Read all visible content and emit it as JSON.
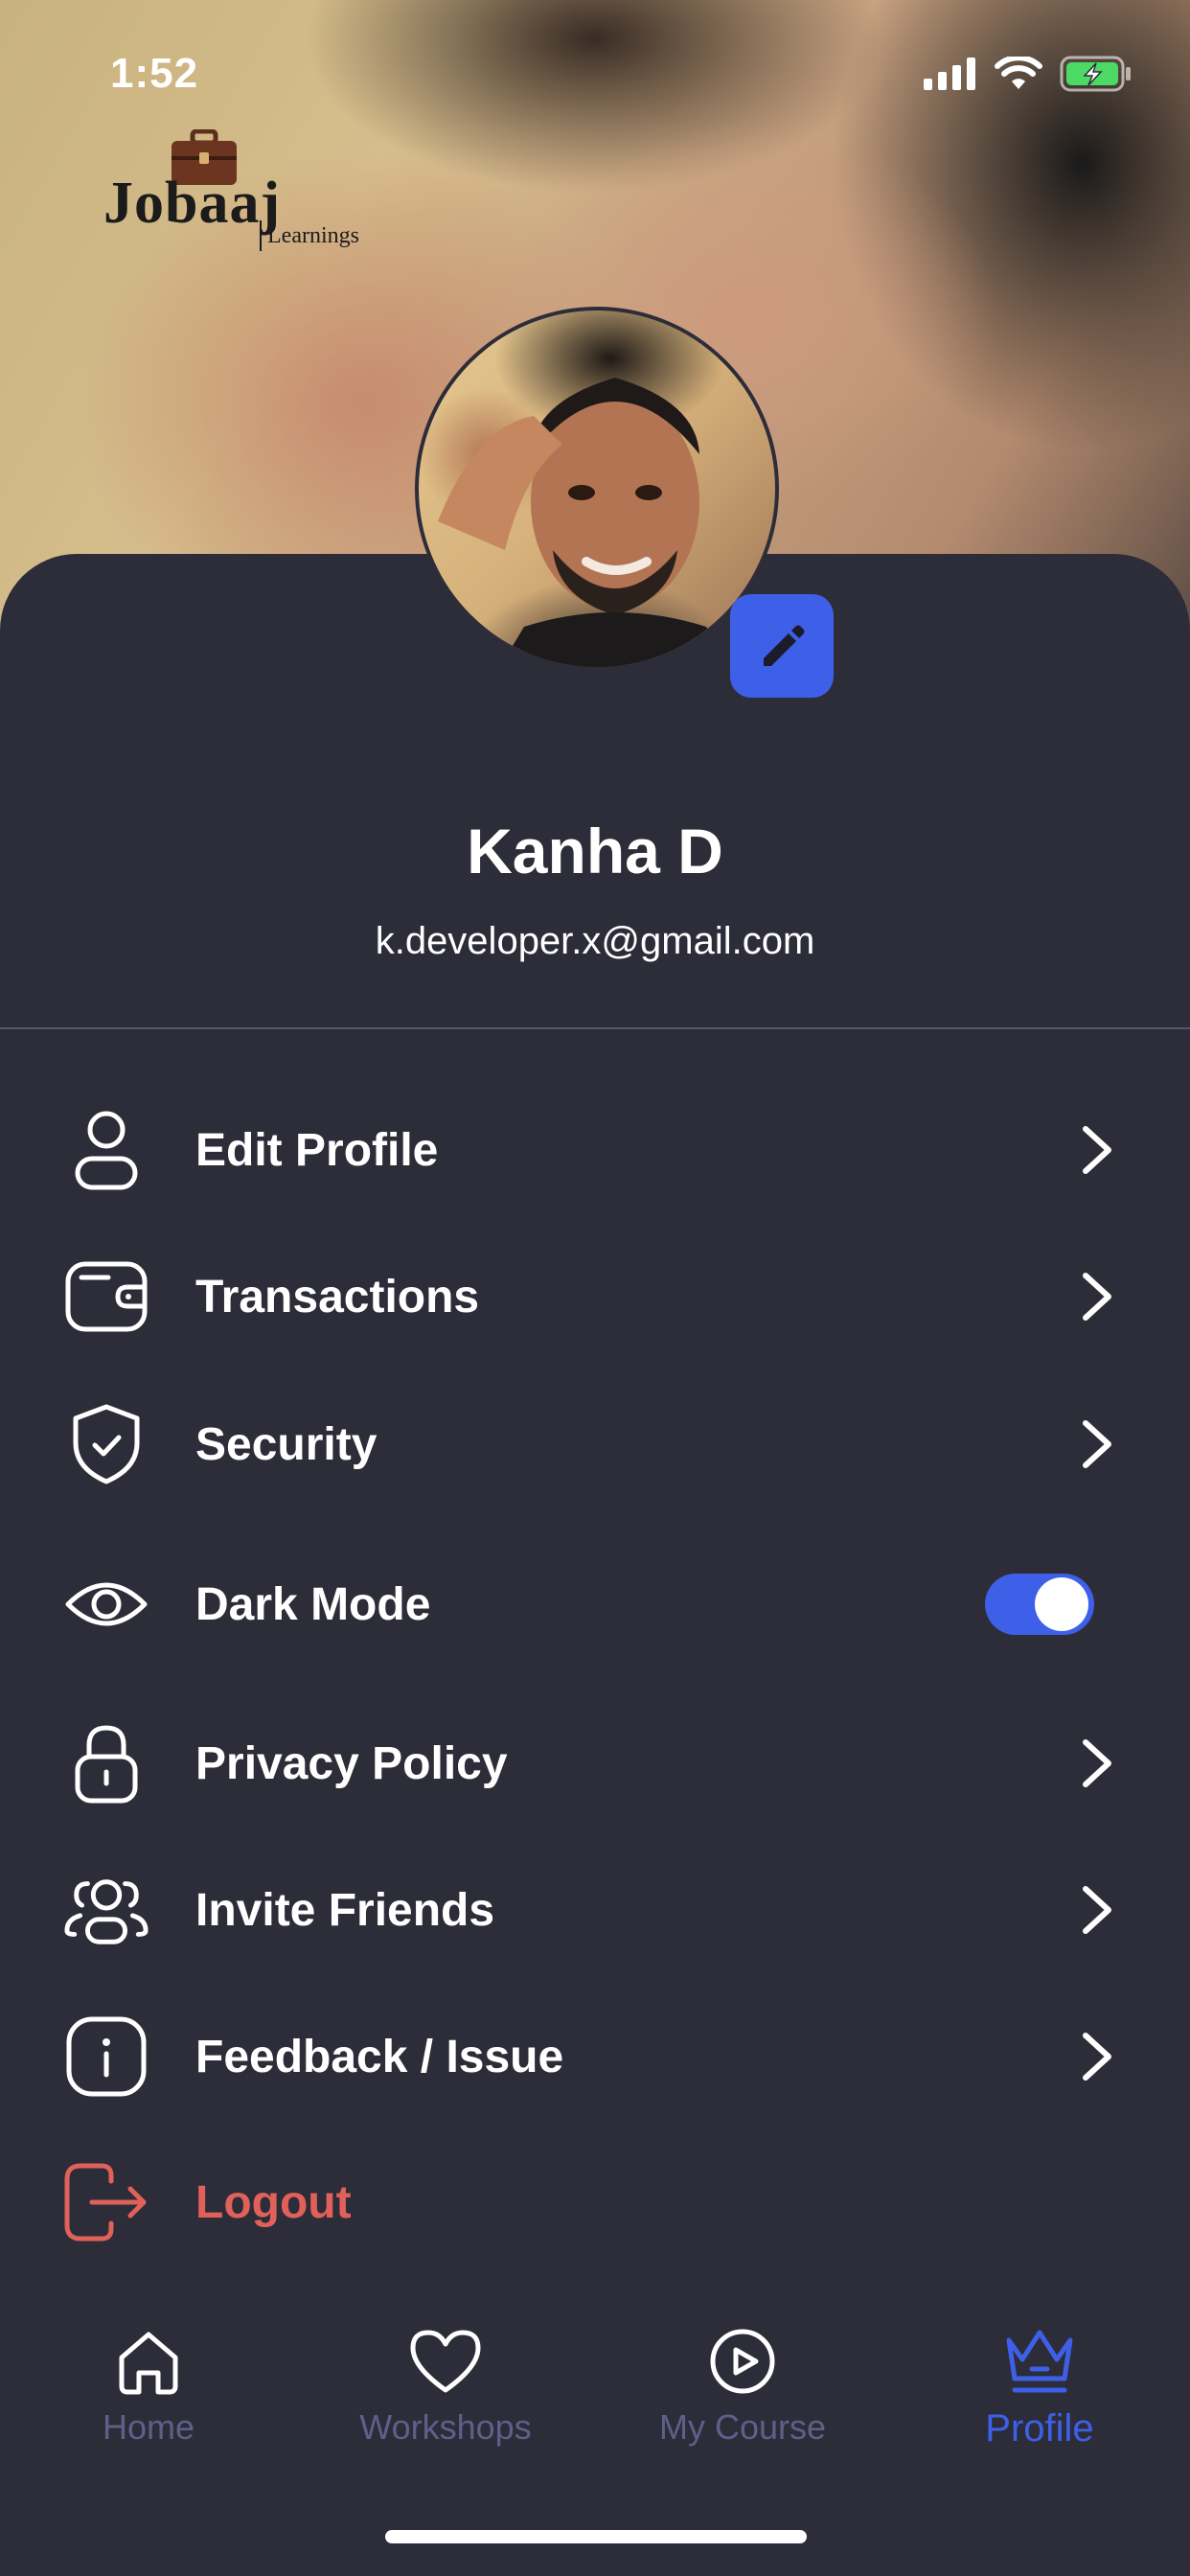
{
  "status_bar": {
    "time": "1:52"
  },
  "brand": {
    "name": "Jobaaj",
    "tagline": "Learnings"
  },
  "profile": {
    "name": "Kanha D",
    "email": "k.developer.x@gmail.com"
  },
  "menu": {
    "edit_profile": "Edit Profile",
    "transactions": "Transactions",
    "security": "Security",
    "dark_mode": "Dark Mode",
    "privacy_policy": "Privacy Policy",
    "invite_friends": "Invite Friends",
    "feedback": "Feedback / Issue",
    "logout": "Logout"
  },
  "dark_mode_enabled": true,
  "nav": {
    "home": "Home",
    "workshops": "Workshops",
    "my_course": "My Course",
    "profile": "Profile",
    "active": "profile"
  },
  "colors": {
    "accent": "#3e5fe8",
    "background": "#2d2d39",
    "logout": "#e0615a",
    "nav_inactive": "#5d6089"
  }
}
